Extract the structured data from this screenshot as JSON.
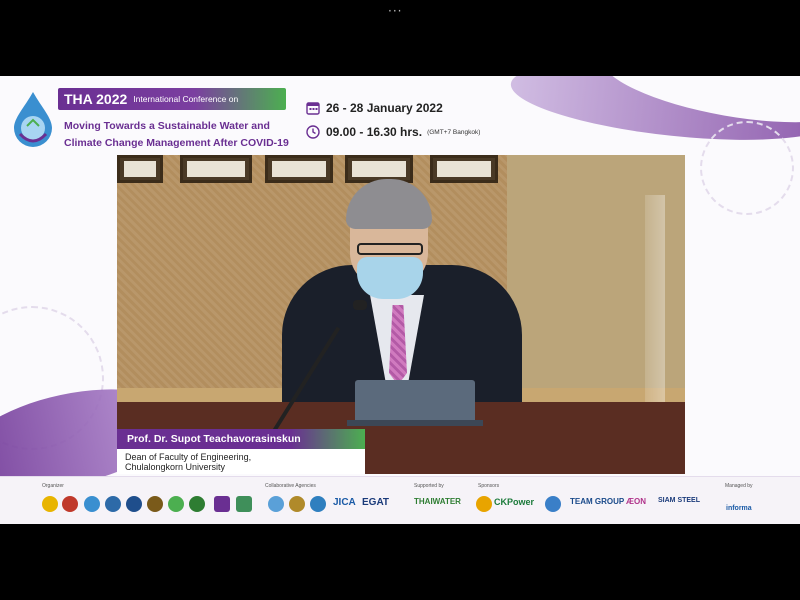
{
  "window": {
    "more_icon": "···"
  },
  "header": {
    "year_title": "THA 2022",
    "conference_label": "International Conference on",
    "main_title_line1": "Moving Towards a Sustainable Water and",
    "main_title_line2": "Climate Change Management After COVID-19",
    "date_icon": "calendar-icon",
    "dates": "26 - 28 January 2022",
    "time_icon": "clock-icon",
    "time": "09.00 - 16.30 hrs.",
    "timezone": "(GMT+7 Bangkok)"
  },
  "speaker": {
    "name": "Prof. Dr. Supot Teachavorasinskun",
    "role_line1": "Dean of Faculty of Engineering,",
    "role_line2": "Chulalongkorn University"
  },
  "sponsors": {
    "organizer_label": "Organizer",
    "collaborative_label": "Collaborative Agencies",
    "supported_label": "Supported by",
    "sponsor_label": "Sponsors",
    "managed_label": "Managed by",
    "logo_jica": "JICA",
    "logo_egat": "EGAT",
    "logo_thaiwater": "THAIWATER",
    "logo_ckpower": "CKPower",
    "logo_team": "TEAM GROUP",
    "logo_aeon": "ÆON",
    "logo_siamsteel": "SIAM STEEL",
    "logo_informa": "informa"
  },
  "colors": {
    "brand_purple": "#6a2f92",
    "accent_green": "#4caf50"
  }
}
